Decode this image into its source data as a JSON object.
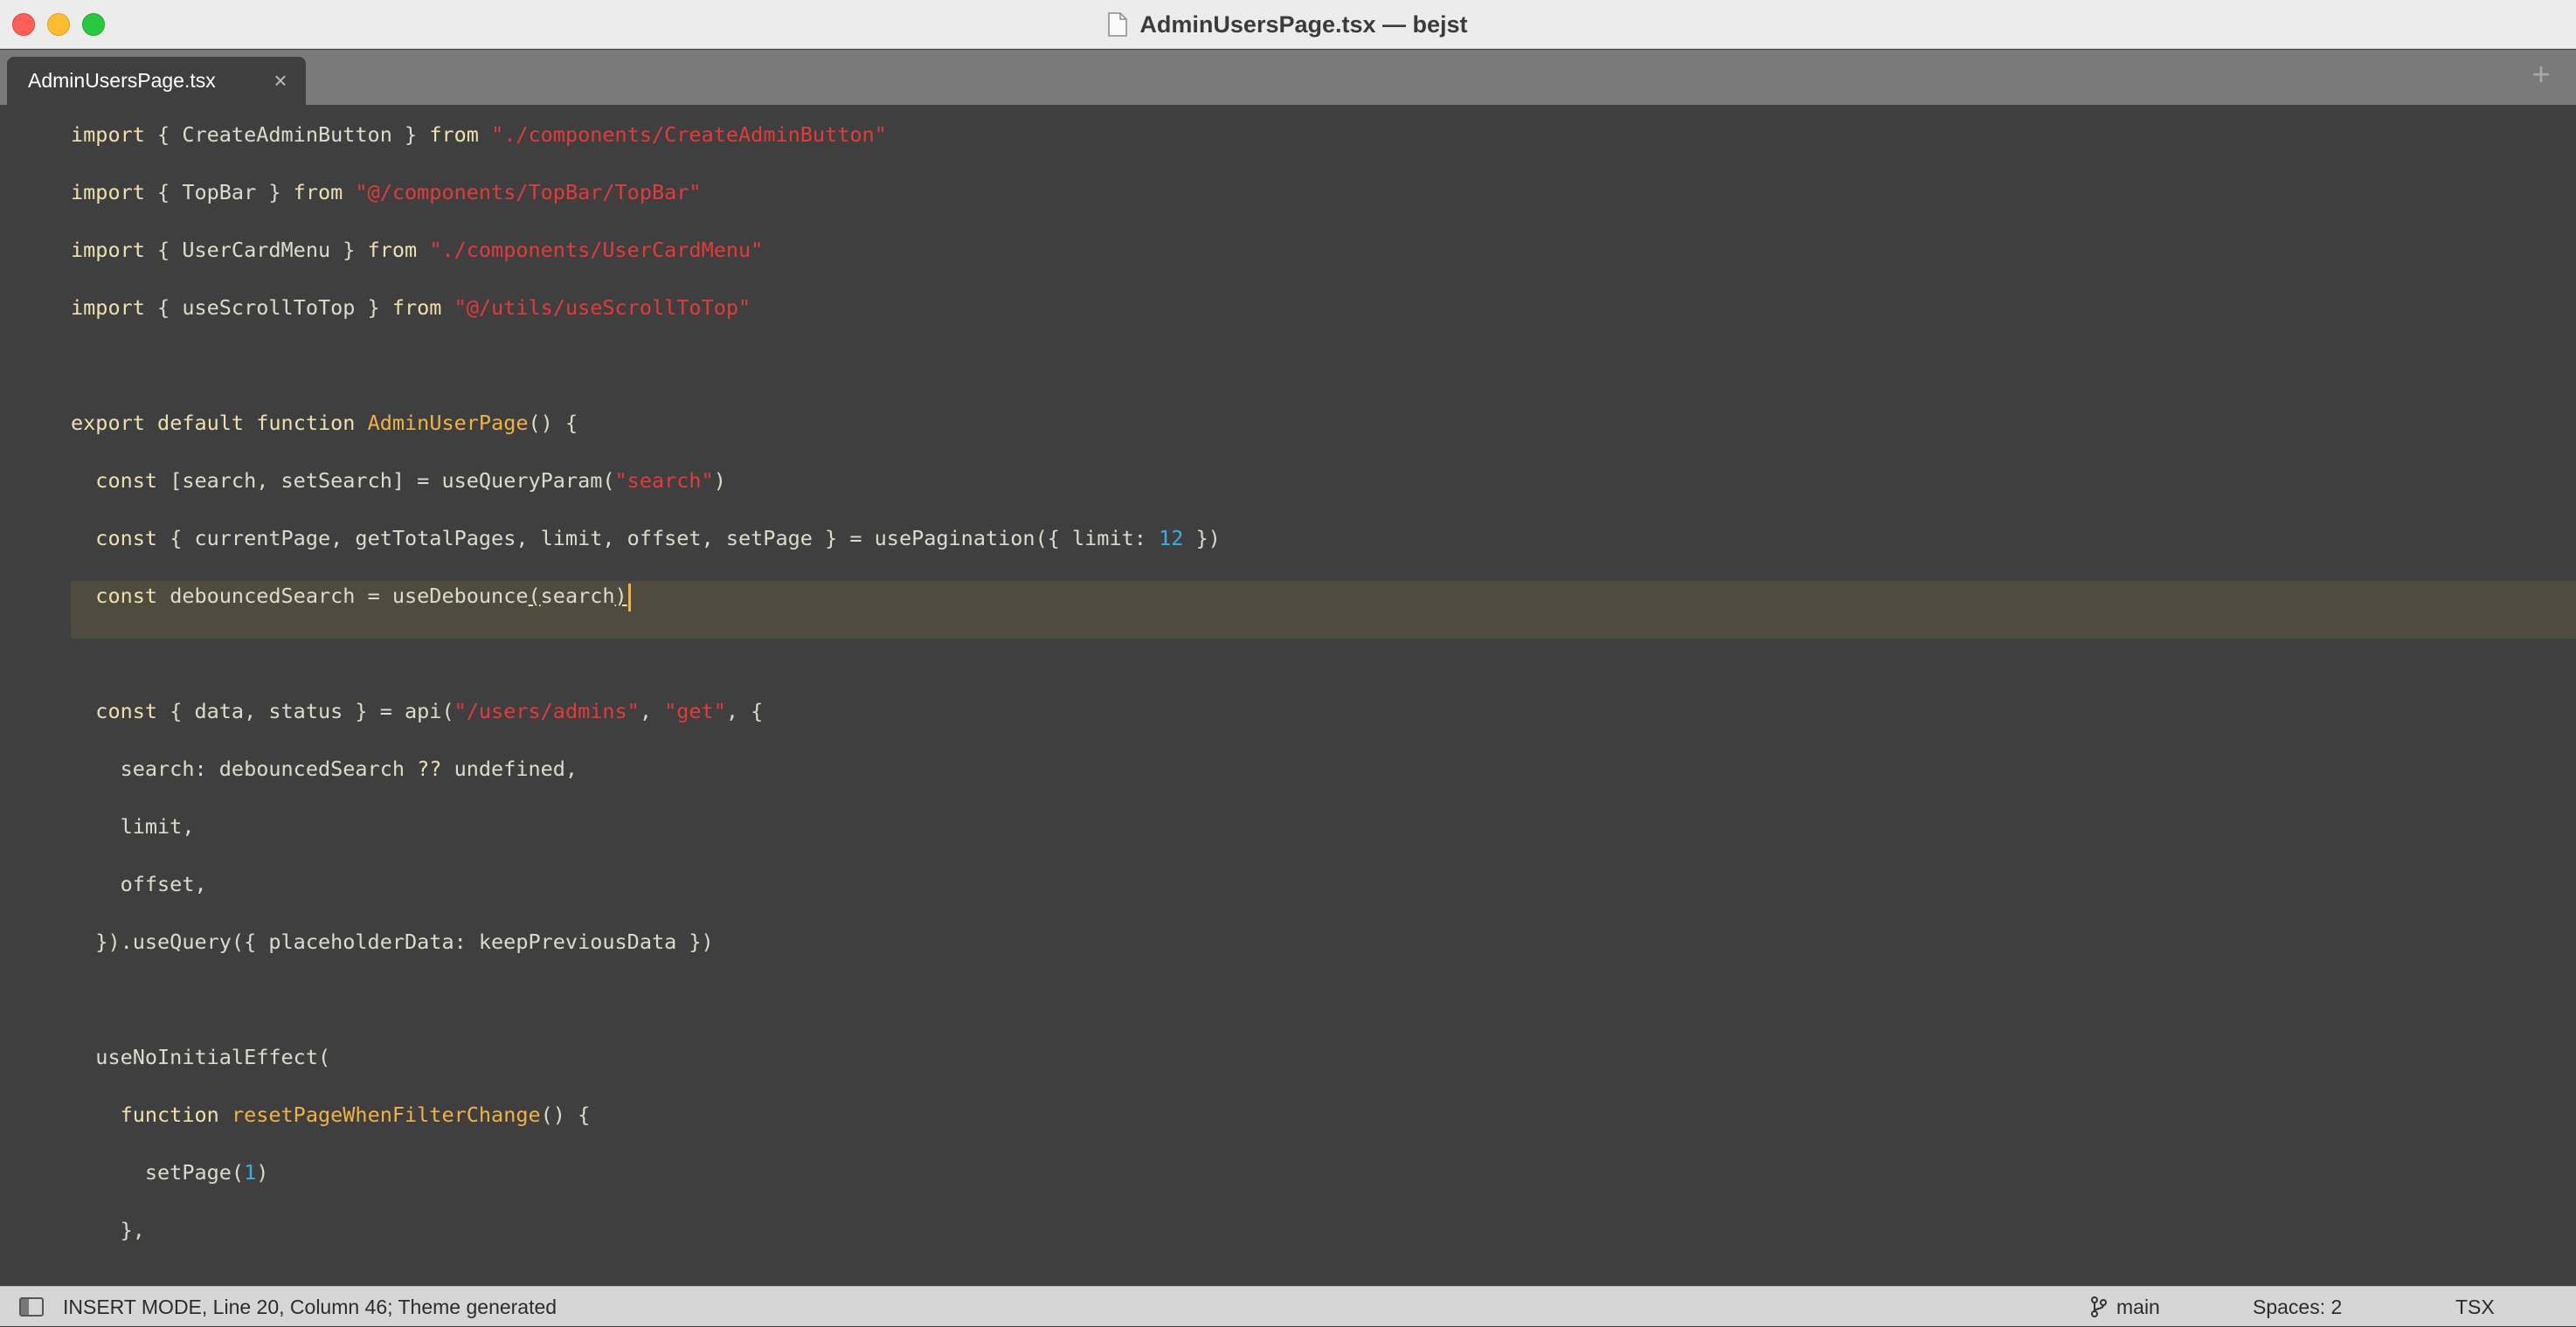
{
  "window": {
    "title": "AdminUsersPage.tsx — bejst"
  },
  "tabs": [
    {
      "label": "AdminUsersPage.tsx",
      "close_glyph": "×",
      "active": true
    }
  ],
  "new_tab_glyph": "+",
  "editor": {
    "lines": [
      [
        [
          "k",
          "import"
        ],
        [
          "p",
          " { CreateAdminButton } "
        ],
        [
          "k",
          "from"
        ],
        [
          "p",
          " "
        ],
        [
          "s",
          "\"./components/CreateAdminButton\""
        ]
      ],
      [
        [
          "k",
          "import"
        ],
        [
          "p",
          " { TopBar } "
        ],
        [
          "k",
          "from"
        ],
        [
          "p",
          " "
        ],
        [
          "s",
          "\"@/components/TopBar/TopBar\""
        ]
      ],
      [
        [
          "k",
          "import"
        ],
        [
          "p",
          " { UserCardMenu } "
        ],
        [
          "k",
          "from"
        ],
        [
          "p",
          " "
        ],
        [
          "s",
          "\"./components/UserCardMenu\""
        ]
      ],
      [
        [
          "k",
          "import"
        ],
        [
          "p",
          " { useScrollToTop } "
        ],
        [
          "k",
          "from"
        ],
        [
          "p",
          " "
        ],
        [
          "s",
          "\"@/utils/useScrollToTop\""
        ]
      ],
      [],
      [
        [
          "k",
          "export"
        ],
        [
          "p",
          " "
        ],
        [
          "k",
          "default"
        ],
        [
          "p",
          " "
        ],
        [
          "k",
          "function"
        ],
        [
          "p",
          " "
        ],
        [
          "f",
          "AdminUserPage"
        ],
        [
          "p",
          "() {"
        ]
      ],
      [
        [
          "p",
          "  "
        ],
        [
          "k",
          "const"
        ],
        [
          "p",
          " [search, setSearch] = useQueryParam("
        ],
        [
          "s",
          "\"search\""
        ],
        [
          "p",
          ")"
        ]
      ],
      [
        [
          "p",
          "  "
        ],
        [
          "k",
          "const"
        ],
        [
          "p",
          " { currentPage, getTotalPages, limit, offset, setPage } = usePagination({ limit: "
        ],
        [
          "n",
          "12"
        ],
        [
          "p",
          " })"
        ]
      ],
      [
        [
          "p",
          "  "
        ],
        [
          "k",
          "const"
        ],
        [
          "p",
          " debouncedSearch = useDebounce"
        ],
        [
          "u",
          "("
        ],
        [
          "p",
          "search"
        ],
        [
          "u",
          ")"
        ]
      ],
      [],
      [
        [
          "p",
          "  "
        ],
        [
          "k",
          "const"
        ],
        [
          "p",
          " { data, status } = api("
        ],
        [
          "s",
          "\"/users/admins\""
        ],
        [
          "p",
          ", "
        ],
        [
          "s",
          "\"get\""
        ],
        [
          "p",
          ", {"
        ]
      ],
      [
        [
          "p",
          "    search: debouncedSearch "
        ],
        [
          "k",
          "??"
        ],
        [
          "p",
          " undefined,"
        ]
      ],
      [
        [
          "p",
          "    limit,"
        ]
      ],
      [
        [
          "p",
          "    offset,"
        ]
      ],
      [
        [
          "p",
          "  }).useQuery({ placeholderData: keepPreviousData })"
        ]
      ],
      [],
      [
        [
          "p",
          "  useNoInitialEffect("
        ]
      ],
      [
        [
          "p",
          "    "
        ],
        [
          "k",
          "function"
        ],
        [
          "p",
          " "
        ],
        [
          "f",
          "resetPageWhenFilterChange"
        ],
        [
          "p",
          "() {"
        ]
      ],
      [
        [
          "p",
          "      setPage("
        ],
        [
          "n",
          "1"
        ],
        [
          "p",
          ")"
        ]
      ],
      [
        [
          "p",
          "    },"
        ]
      ]
    ],
    "current_line_index": 8
  },
  "status": {
    "text": "INSERT MODE, Line 20, Column 46; Theme generated",
    "branch": "main",
    "spaces": "Spaces: 2",
    "syntax": "TSX"
  },
  "colors": {
    "keyword": "#f0dfaf",
    "string": "#e23b3b",
    "function": "#f0b246",
    "number": "#38b0de",
    "plain": "#dcdccc",
    "background": "#3f3f3f",
    "current_line": "#4f4b3e"
  }
}
